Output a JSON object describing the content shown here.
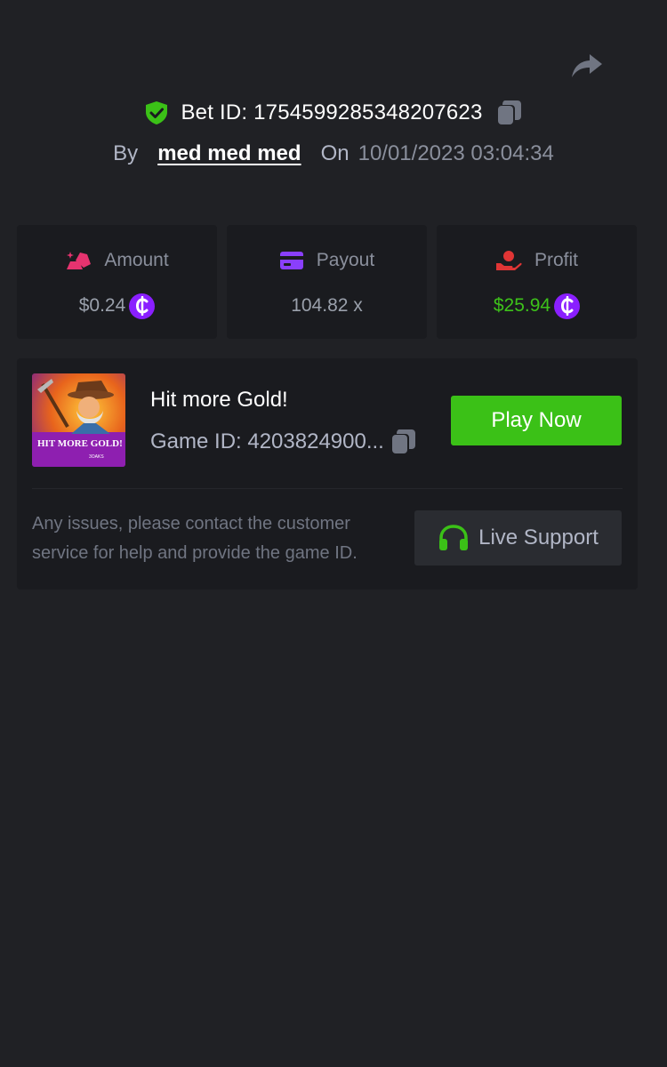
{
  "header": {
    "share_icon": "share-arrow-icon",
    "bet_id_label": "Bet ID: 1754599285348207623",
    "verified_icon": "shield-check-icon",
    "by_label": "By",
    "username": "med med med",
    "on_label": "On",
    "date": "10/01/2023 03:04:34"
  },
  "stats": [
    {
      "label": "Amount",
      "value": "$0.24",
      "icon": "gold-bars-icon",
      "icon_color": "#e6336f",
      "has_coin": true,
      "value_color": "#9aa0ab"
    },
    {
      "label": "Payout",
      "value": "104.82 x",
      "icon": "credit-card-icon",
      "icon_color": "#8a3ffc",
      "has_coin": false,
      "value_color": "#9aa0ab"
    },
    {
      "label": "Profit",
      "value": "$25.94",
      "icon": "hand-money-icon",
      "icon_color": "#e03535",
      "has_coin": true,
      "value_color": "#3dc21a"
    }
  ],
  "game": {
    "title": "Hit more Gold!",
    "game_id_label": "Game ID: 4203824900...",
    "thumbnail_text": "HIT MORE GOLD!",
    "thumbnail_badge": "3OAKS",
    "play_button": "Play Now"
  },
  "support": {
    "text": "Any issues, please contact the customer service for help and provide the game ID.",
    "button": "Live Support",
    "button_icon": "headset-icon"
  },
  "colors": {
    "background": "#202125",
    "card": "#1a1b1f",
    "accent_green": "#3bc117",
    "coin_purple": "#8a1fff"
  }
}
